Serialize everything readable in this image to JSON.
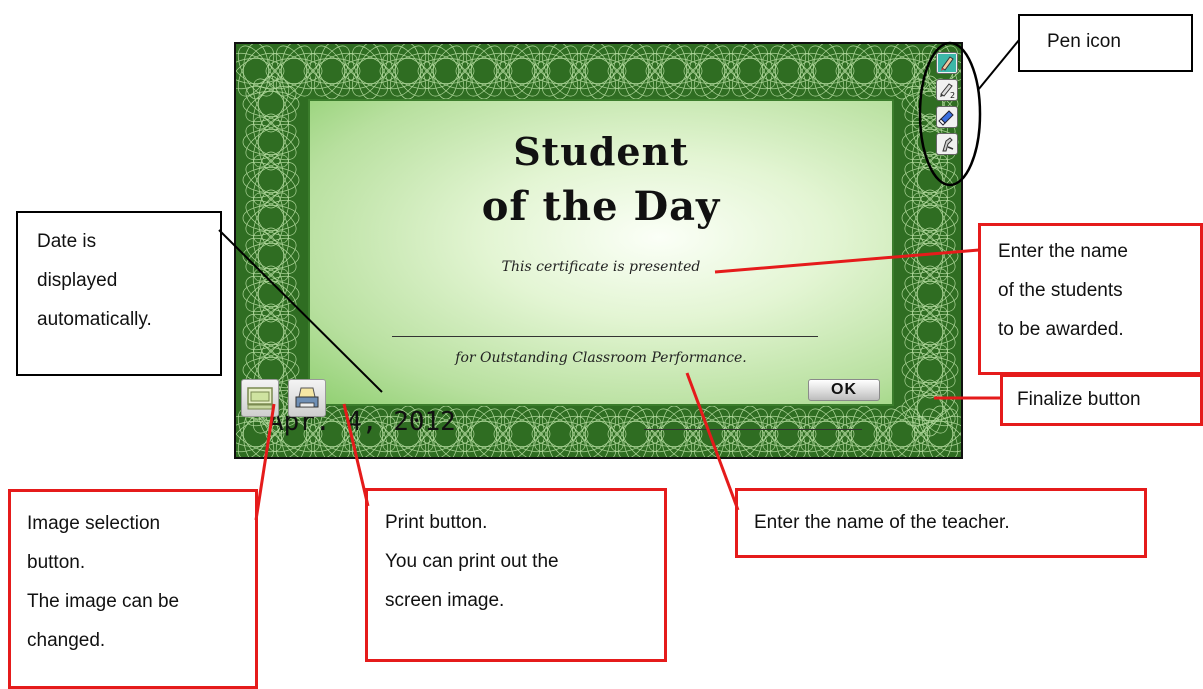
{
  "certificate": {
    "title_line1": "Student",
    "title_line2": "of the Day",
    "presented_text": "This certificate is presented",
    "outstanding_text": "for Outstanding Classroom Performance.",
    "date": "Apr. 4, 2012",
    "ok_label": "OK"
  },
  "tools": [
    {
      "icon": "pen-1-icon",
      "badge": "1"
    },
    {
      "icon": "pen-2-icon",
      "badge": "2"
    },
    {
      "icon": "eraser-icon"
    },
    {
      "icon": "settings-tool-icon"
    }
  ],
  "callouts": {
    "pen_icon": "Pen icon",
    "date": [
      "Date is",
      "displayed",
      "automatically."
    ],
    "student_name": [
      "Enter the name",
      "of the students",
      "to be awarded."
    ],
    "finalize": "Finalize button",
    "image_selection": [
      "Image selection",
      "button.",
      "The image can be",
      "changed."
    ],
    "print": [
      "Print button.",
      "You can print out the",
      "screen image."
    ],
    "teacher": "Enter the name of the teacher."
  },
  "colors": {
    "border_green": "#2f6d22",
    "inner_green": "#b8e09f",
    "callout_red": "#e51b1b"
  }
}
